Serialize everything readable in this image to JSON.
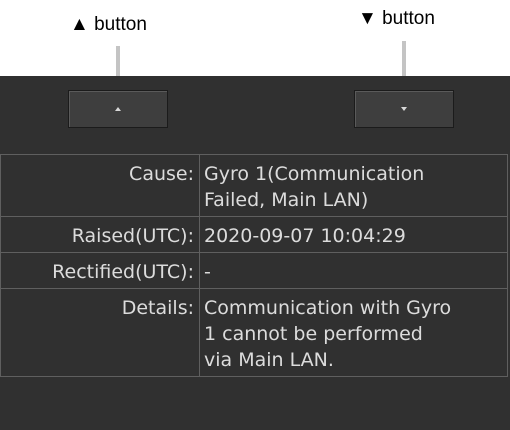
{
  "callouts": {
    "up_button": "▲ button",
    "down_button": "▼ button"
  },
  "controls": {
    "up_icon": "caret-up-icon",
    "down_icon": "caret-down-icon"
  },
  "details": {
    "cause_label": "Cause:",
    "cause_value_lines": [
      "Gyro 1(Communication",
      "Failed, Main LAN)"
    ],
    "raised_label": "Raised(UTC):",
    "raised_value": "2020-09-07 10:04:29",
    "rectified_label": "Rectified(UTC):",
    "rectified_value": "-",
    "details_label": "Details:",
    "details_value_lines": [
      "Communication with Gyro",
      "1 cannot be performed",
      "via Main LAN."
    ]
  }
}
